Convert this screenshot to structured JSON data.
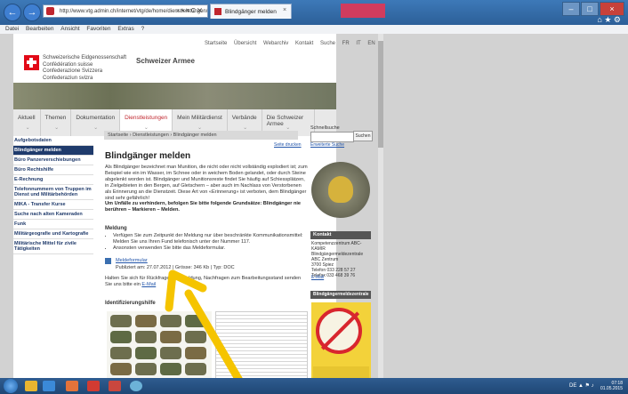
{
  "browser": {
    "url": "http://www.vtg.admin.ch/internet/vtg/de/home/dienstleistungen/b...",
    "url_controls": "⌕ ▾ ≡ C ✕",
    "tab_title": "Blindgänger melden",
    "tab_close": "×",
    "back": "←",
    "forward": "→",
    "menu": [
      "Datei",
      "Bearbeiten",
      "Ansicht",
      "Favoriten",
      "Extras",
      "?"
    ],
    "toolbar_icons": "⌂ ★ ⚙"
  },
  "site": {
    "topnav": [
      "Startseite",
      "Übersicht",
      "Webarchiv",
      "Kontakt",
      "Suche",
      "FR",
      "IT",
      "EN"
    ],
    "confederation": [
      "Schweizerische Eidgenossenschaft",
      "Confédération suisse",
      "Confederazione Svizzera",
      "Confederaziun svizra"
    ],
    "title": "Schweizer Armee",
    "tabs": [
      "Aktuell",
      "Themen",
      "Dokumentation",
      "Dienstleistungen",
      "Mein Militärdienst",
      "Verbände",
      "Die Schweizer Armee"
    ],
    "chevron": "⌄"
  },
  "sidebar": [
    "Aufgebotsdaten",
    "Blindgänger melden",
    "Büro Panzerverschiebungen",
    "Büro Rechtshilfe",
    "E-Rechnung",
    "Telefonnummern von Truppen im Dienst und Militärbehörden",
    "MIKA - Transfer Kurse",
    "Suche nach alten Kameraden",
    "Funk",
    "Militärgeografie und Kartografie",
    "Militärische Mittel für zivile Tätigkeiten"
  ],
  "main": {
    "breadcrumb": "Startseite › Dienstleistungen › Blindgänger melden",
    "print": "Seite drucken",
    "title": "Blindgänger melden",
    "intro": "Als Blindgänger bezeichnet man Munition, die nicht oder nicht vollständig explodiert ist; zum Beispiel wie ein im Wasser, im Schnee oder in weichem Boden gelandet, oder durch Steine abgelenkt worden ist. Blindgänger und Munitionsreste findet Sie häufig auf Schiessplätzen, in Zielgebieten in den Bergen, auf Gletschern – aber auch im Nachlass von Verstorbenen als Erinnerung an die Dienstzeit. Diese Art von «Erinnerung» ist verboten, dem Blindgänger sind sehr gefährlich!",
    "warning": "Um Unfälle zu verhindern, befolgen Sie bitte folgende Grundsätze: Blindgänger nie berühren – Markieren – Melden.",
    "meldung_heading": "Meldung",
    "meldung_items": [
      "Verfügen Sie zum Zeitpunkt der Meldung nur über beschränkte Kommunikationsmittel: Melden Sie uns Ihren Fund telefonisch unter der Nummer 117.",
      "Ansonsten verwenden Sie bitte das Meldeformular."
    ],
    "form_link": "Meldeformular",
    "form_meta": "Publiziert am: 27.07.2012 | Grösse: 346 Kb | Typ: DOC",
    "contact_text": "Halten Sie sich für Rückfragen zur Meldung, Nachfragen zum Bearbeitungsstand senden Sie uns bitte ein",
    "email_link": "E-Mail",
    "id_heading": "Identifizierungshilfe"
  },
  "right": {
    "search_heading": "Schnellsuche",
    "search_button": "Suchen",
    "advanced": "Erweiterte Suche",
    "kontakt_heading": "Kontakt",
    "kontakt_lines": [
      "Kompetenzzentrum ABC-KAMIR",
      "Blindgängermeldezentrale",
      "ABC Zentrum",
      "3700 Spiez",
      "",
      "Telefon 033 228 57 27",
      "Telefax 033 468 39 76"
    ],
    "kontakt_email": "E-Mail",
    "bmz_heading": "Blindgängermeldezentrale"
  },
  "taskbar": {
    "time": "07:18",
    "date": "01.05.2015",
    "tray_icons": "DE ▲ ⚑ ♪"
  },
  "colors": {
    "swiss_red": "#e20917",
    "nav_blue": "#1f3b6c",
    "annotation_arrow": "#f5c400"
  }
}
